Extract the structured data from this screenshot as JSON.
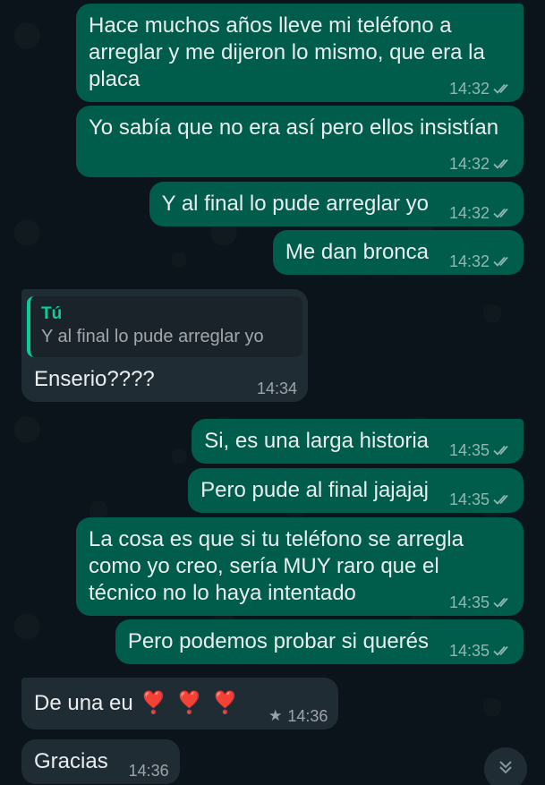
{
  "messages": [
    {
      "direction": "out",
      "text": "Hace muchos años lleve mi teléfono a arreglar y me dijeron lo mismo, que era la placa",
      "time": "14:32",
      "status": "read"
    },
    {
      "direction": "out",
      "text": "Yo sabía que no era así pero ellos insistían",
      "time": "14:32",
      "status": "read"
    },
    {
      "direction": "out",
      "text": "Y al final lo pude arreglar yo",
      "time": "14:32",
      "status": "read"
    },
    {
      "direction": "out",
      "text": "Me dan bronca",
      "time": "14:32",
      "status": "read"
    },
    {
      "direction": "in",
      "quote_author": "Tú",
      "quote_text": "Y al final lo pude arreglar yo",
      "text": "Enserio????",
      "time": "14:34"
    },
    {
      "direction": "out",
      "text": "Si, es una larga historia",
      "time": "14:35",
      "status": "read"
    },
    {
      "direction": "out",
      "text": "Pero pude al final jajajaj",
      "time": "14:35",
      "status": "read"
    },
    {
      "direction": "out",
      "text": "La cosa es que si tu teléfono se arregla como yo creo, sería MUY raro que el técnico no lo haya intentado",
      "time": "14:35",
      "status": "read"
    },
    {
      "direction": "out",
      "text": "Pero podemos probar si querés",
      "time": "14:35",
      "status": "read"
    },
    {
      "direction": "in",
      "text": "De una eu",
      "emoji": "❣️❣️❣️",
      "time": "14:36",
      "starred": true
    },
    {
      "direction": "in",
      "text": "Gracias",
      "time": "14:36"
    }
  ],
  "icons": {
    "read_ticks": "double-check-icon",
    "star": "star-icon",
    "scroll_down": "chevron-double-down-icon"
  },
  "colors": {
    "background": "#0b141a",
    "outgoing_bubble": "#005c4b",
    "incoming_bubble": "#202c33",
    "quote_accent": "#06cf9c",
    "heart": "#e0142b"
  }
}
